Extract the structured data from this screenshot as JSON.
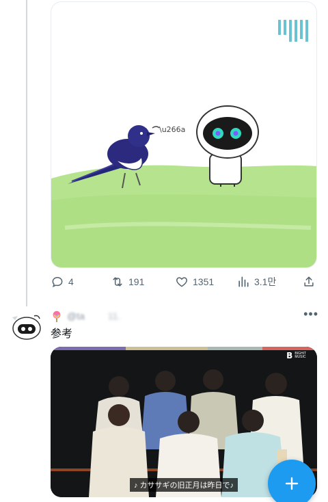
{
  "tweet1": {
    "media": {
      "logo_glyphs": "ㄱㄱㄱㄱ",
      "watermark_icon": "sparkle-logo"
    },
    "actions": {
      "replies": "4",
      "retweets": "191",
      "likes": "1351",
      "views": "3.1만"
    }
  },
  "tweet2": {
    "handle": "@ta",
    "date": "11.",
    "text": "参考",
    "more_label": "•••",
    "video": {
      "subtitle": "♪ カササギの旧正月は昨日で♪",
      "logo_mark": "B",
      "logo_text_line1": "BIGHIT",
      "logo_text_line2": "MUSIC"
    }
  },
  "colors": {
    "accent": "#1d9bf0",
    "secondary_text": "#536471",
    "divider": "#cfd9de"
  }
}
